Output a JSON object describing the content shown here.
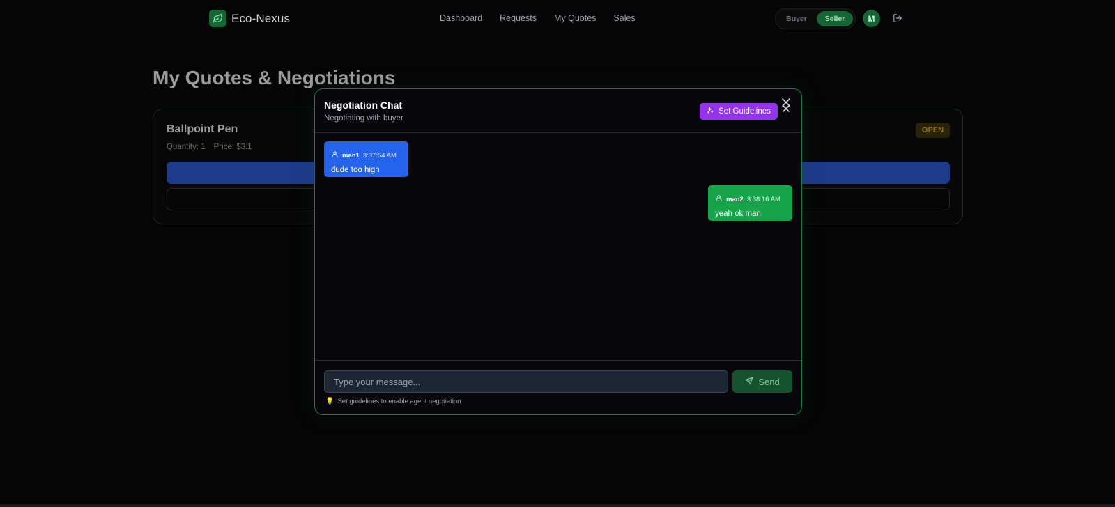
{
  "header": {
    "brand": "Eco-Nexus",
    "nav": [
      "Dashboard",
      "Requests",
      "My Quotes",
      "Sales"
    ],
    "roles": {
      "buyer": "Buyer",
      "seller": "Seller",
      "active": "Seller"
    },
    "avatar_initial": "M"
  },
  "page": {
    "title": "My Quotes & Negotiations",
    "quote": {
      "name": "Ballpoint Pen",
      "quantity": "Quantity: 1",
      "price": "Price: $3.1",
      "status": "OPEN"
    }
  },
  "chat": {
    "title": "Negotiation Chat",
    "subtitle": "Negotiating with buyer",
    "guidelines_label": "Set Guidelines",
    "messages": [
      {
        "user": "man1",
        "time": "3:37:54 AM",
        "text": "dude too high",
        "side": "left"
      },
      {
        "user": "man2",
        "time": "3:38:16 AM",
        "text": "yeah ok man",
        "side": "right"
      }
    ],
    "input_placeholder": "Type your message...",
    "send_label": "Send",
    "hint": "Set guidelines to enable agent negotiation"
  },
  "colors": {
    "accent": "#16a34a",
    "buyer_bubble": "#2563eb",
    "guidelines": "#9333ea"
  },
  "icons": {
    "brand": "leaf-icon",
    "logout": "logout-icon",
    "guidelines": "sparkles-icon",
    "close": "close-icon",
    "user": "user-icon",
    "send": "send-icon",
    "hint": "lightbulb-icon"
  }
}
